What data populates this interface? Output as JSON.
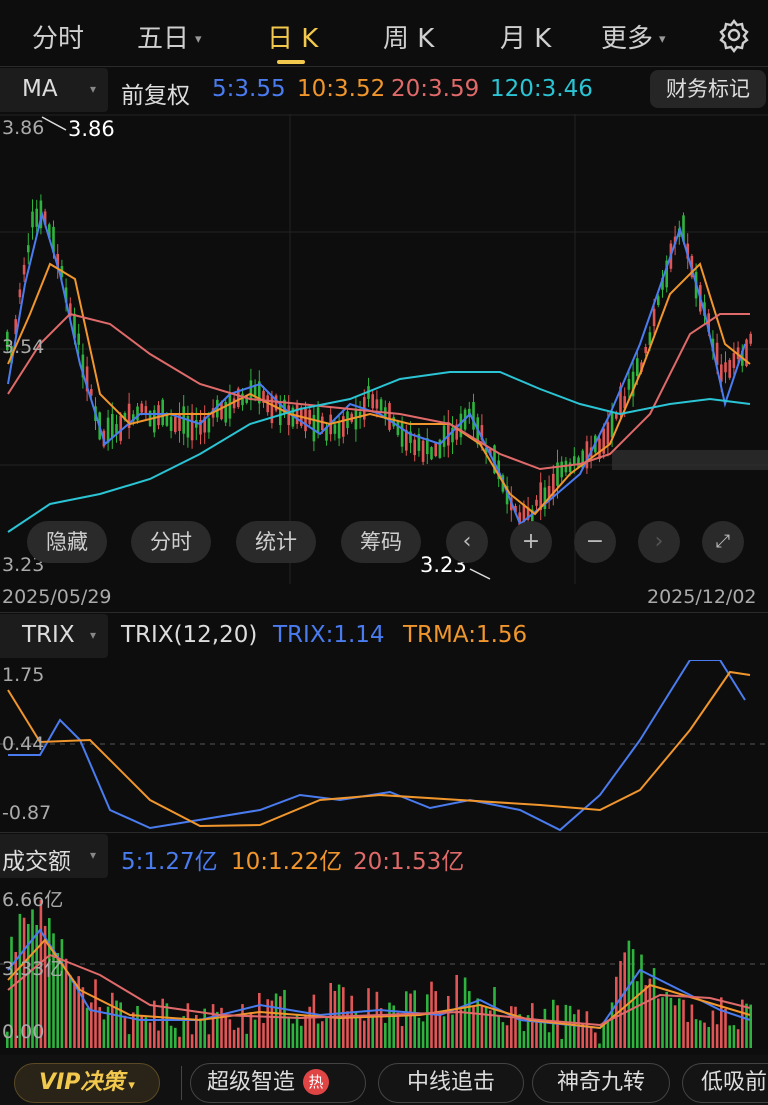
{
  "tabs": [
    {
      "label": "分时"
    },
    {
      "label": "五日",
      "dropdown": true
    },
    {
      "label": "日 K",
      "active": true
    },
    {
      "label": "周 K"
    },
    {
      "label": "月 K"
    },
    {
      "label": "更多",
      "dropdown": true
    }
  ],
  "settings_icon": "gear-icon",
  "ma": {
    "selector": "MA",
    "adjust": "前复权",
    "ma5": "5:3.55",
    "ma10": "10:3.52",
    "ma20": "20:3.59",
    "ma120": "120:3.46",
    "financial_marker": "财务标记"
  },
  "price_axis": {
    "top": "3.86",
    "mid": "3.54",
    "bottom": "3.23",
    "high_marker": "3.86",
    "low_marker": "3.23"
  },
  "date_axis": {
    "start": "2025/05/29",
    "end": "2025/12/02"
  },
  "chart_controls": {
    "hide": "隐藏",
    "timeshare": "分时",
    "stats": "统计",
    "chips": "筹码",
    "prev_icon": "chevron-left-icon",
    "zoom_in_icon": "plus-icon",
    "zoom_out_icon": "minus-icon",
    "next_icon": "chevron-right-icon",
    "fullscreen_icon": "fullscreen-icon"
  },
  "trix": {
    "selector": "TRIX",
    "params": "TRIX(12,20)",
    "trix_value": "TRIX:1.14",
    "trma_value": "TRMA:1.56",
    "axis_top": "1.75",
    "axis_mid": "0.44",
    "axis_bottom": "-0.87"
  },
  "volume": {
    "selector": "成交额",
    "v5": "5:1.27亿",
    "v10": "10:1.22亿",
    "v20": "20:1.53亿",
    "axis_top": "6.66亿",
    "axis_mid": "3.33亿",
    "axis_bottom": "0.00"
  },
  "bottom_bar": {
    "vip_label": "VIP",
    "vip_text": "决策",
    "items": [
      {
        "label": "超级智造",
        "badge": "热"
      },
      {
        "label": "中线追击"
      },
      {
        "label": "神奇九转"
      },
      {
        "label": "低吸前"
      }
    ]
  },
  "colors": {
    "up": "#e05555",
    "down": "#2fb33f",
    "ma5": "#4a7cf0",
    "ma10": "#f0962d",
    "ma20": "#e06a6a",
    "ma120": "#2bc4d4",
    "accent": "#f2c94c"
  }
}
